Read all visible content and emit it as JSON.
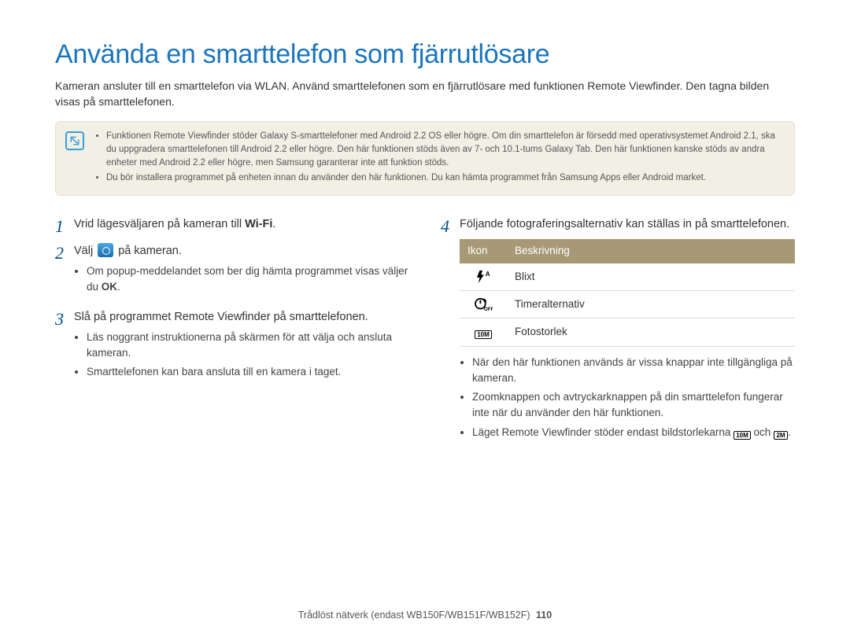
{
  "title": "Använda en smarttelefon som fjärrutlösare",
  "intro": "Kameran ansluter till en smarttelefon via WLAN. Använd smarttelefonen som en fjärrutlösare med funktionen Remote Viewfinder. Den tagna bilden visas på smarttelefonen.",
  "note": {
    "items": [
      "Funktionen Remote Viewfinder stöder Galaxy S-smarttelefoner med Android 2.2 OS eller högre. Om din smarttelefon är försedd med operativsystemet Android 2.1, ska du uppgradera smarttelefonen till Android 2.2 eller högre. Den här funktionen stöds även av 7- och 10.1-tums Galaxy Tab. Den här funktionen kanske stöds av andra enheter med Android 2.2 eller högre, men Samsung garanterar inte att funktion stöds.",
      "Du bör installera programmet på enheten innan du använder den här funktionen. Du kan hämta programmet från Samsung Apps eller Android market."
    ]
  },
  "steps": {
    "s1": {
      "num": "1",
      "pre": "Vrid lägesväljaren på kameran till ",
      "wifi": "Wi-Fi",
      "post": "."
    },
    "s2": {
      "num": "2",
      "pre": "Välj ",
      "post": " på kameran.",
      "sub": [
        "Om popup-meddelandet som ber dig hämta programmet visas väljer du OK."
      ]
    },
    "s3": {
      "num": "3",
      "text": "Slå på programmet Remote Viewfinder på smarttelefonen.",
      "sub": [
        "Läs noggrant instruktionerna på skärmen för att välja och ansluta kameran.",
        "Smarttelefonen kan bara ansluta till en kamera i taget."
      ]
    },
    "s4": {
      "num": "4",
      "text": "Följande fotograferingsalternativ kan ställas in på smarttelefonen."
    }
  },
  "table": {
    "head": {
      "icon": "Ikon",
      "desc": "Beskrivning"
    },
    "rows": [
      {
        "icon": "flash",
        "label": "Blixt"
      },
      {
        "icon": "timer",
        "label": "Timeralternativ"
      },
      {
        "icon": "size10",
        "label": "Fotostorlek"
      }
    ]
  },
  "right_bullets": {
    "b1": "När den här funktionen används är vissa knappar inte tillgängliga på kameran.",
    "b2": "Zoomknappen och avtryckarknappen på din smarttelefon fungerar inte när du använder den här funktionen.",
    "b3_pre": "Läget Remote Viewfinder stöder endast bildstorlekarna ",
    "b3_mid": " och ",
    "b3_post": ".",
    "size_a": "10M",
    "size_b": "2M"
  },
  "footer": {
    "text": "Trådlöst nätverk (endast WB150F/WB151F/WB152F)",
    "page": "110"
  },
  "ok_label": "OK"
}
